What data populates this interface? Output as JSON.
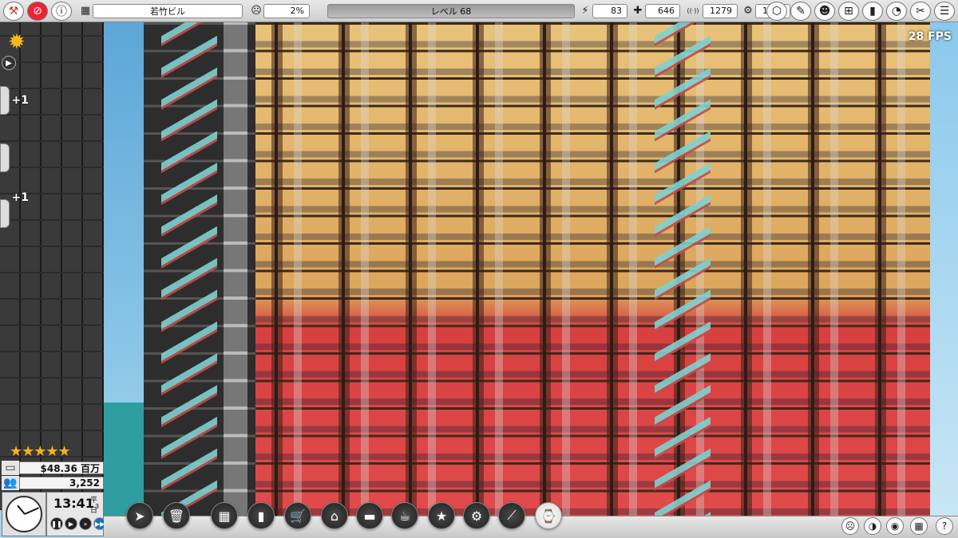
{
  "topbar": {
    "building_name": "若竹ビル",
    "happiness": "2%",
    "level": "レベル 68",
    "stats": [
      {
        "icon": "lightning-icon",
        "glyph": "⚡",
        "value": "83"
      },
      {
        "icon": "water-icon",
        "glyph": "✚",
        "value": "646"
      },
      {
        "icon": "signal-icon",
        "glyph": "((·))",
        "value": "1279"
      },
      {
        "icon": "gear-icon",
        "glyph": "⚙",
        "value": "1573"
      }
    ]
  },
  "fps": "28 FPS",
  "left_panel": {
    "plus_badges": [
      "+1",
      "+1"
    ]
  },
  "status": {
    "stars": "★★★★★",
    "money": "$48.36 百万",
    "population": "3,252",
    "time": "13:41",
    "day_type": "平日",
    "day_num": "3",
    "speed_active": "fast-forward"
  },
  "colors": {
    "wall_warm": "#e9c47a",
    "floor_red": "#e14b4b",
    "escalator": "#7fd1cf",
    "toolbar": "#e0e0e0"
  },
  "toolbar_icons": [
    "cursor-icon",
    "trash-icon",
    "add-floor-icon",
    "utilities-icon",
    "shopping-cart-icon",
    "sofa-icon",
    "bed-icon",
    "coffee-icon",
    "stars-icon",
    "maintenance-icon",
    "escalator-icon",
    "watch-icon"
  ],
  "bottom_right_icons": [
    "mood-icon",
    "contrast-icon",
    "eye-icon",
    "grid-icon",
    "help-icon"
  ]
}
